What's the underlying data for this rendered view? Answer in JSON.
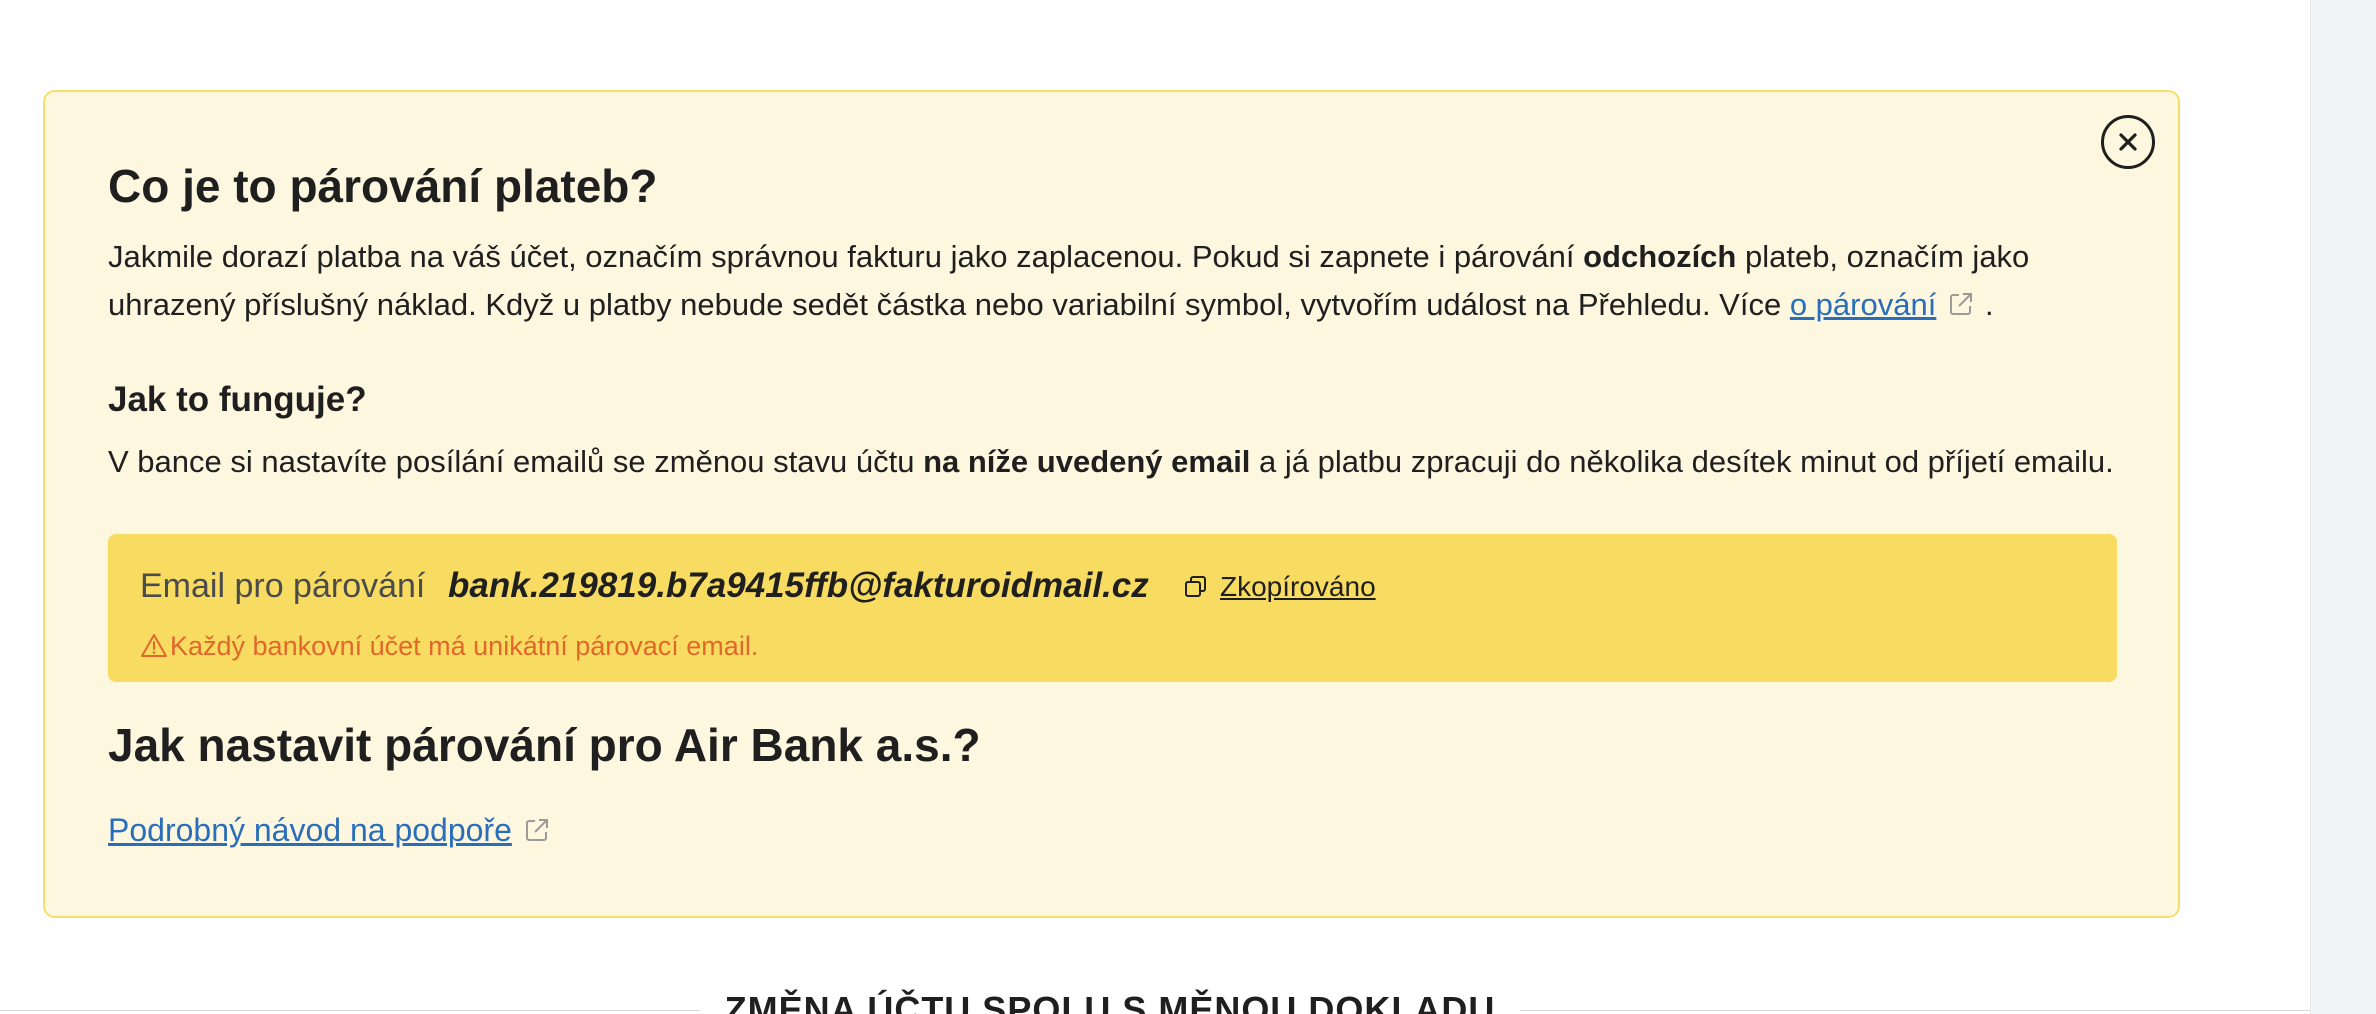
{
  "info": {
    "title": "Co je to párování plateb?",
    "intro": {
      "text1": "Jakmile dorazí platba na váš účet, označím správnou fakturu jako zaplacenou. Pokud si zapnete i párování ",
      "bold": "odchozích",
      "text2": " plateb, označím jako uhrazený příslušný náklad. Když u platby nebude sedět částka nebo variabilní symbol, vytvořím událost na Přehledu. Více ",
      "link": "o párování",
      "end": " ."
    },
    "how_title": "Jak to funguje?",
    "how": {
      "text1": "V bance si nastavíte posílání emailů se změnou stavu účtu ",
      "bold": "na níže uvedený email",
      "text2": " a já platbu zpracuji do několika desítek minut od příjetí emailu."
    },
    "email": {
      "label": "Email pro párování",
      "value": "bank.219819.b7a9415ffb@fakturoidmail.cz",
      "copy_label": "Zkopírováno",
      "warning": "Každý bankovní účet má unikátní párovací email."
    },
    "bank_title": "Jak nastavit párování pro Air Bank a.s.?",
    "guide_link": "Podrobný návod na podpoře"
  },
  "bottom": {
    "heading": "ZMĚNA ÚČTU SPOLU S MĚNOU DOKLADU"
  },
  "colors": {
    "box_bg": "#fdf7e0",
    "box_border": "#f3df6c",
    "email_bg": "#f8dc62",
    "link": "#2a6ebb",
    "warning": "#e2672b"
  },
  "icons": {
    "close": "close-icon",
    "external": "external-link-icon",
    "copy": "copy-icon",
    "warning": "warning-icon"
  }
}
